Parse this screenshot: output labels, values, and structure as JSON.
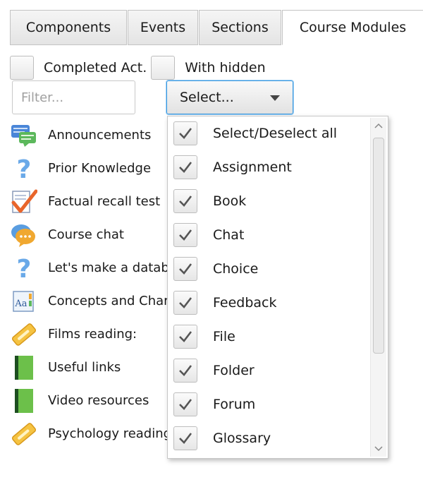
{
  "tabs": [
    {
      "label": "Components",
      "active": false
    },
    {
      "label": "Events",
      "active": false
    },
    {
      "label": "Sections",
      "active": false
    },
    {
      "label": "Course Modules",
      "active": true
    }
  ],
  "options": {
    "completed_label": "Completed Act.",
    "hidden_label": "With hidden"
  },
  "filter": {
    "placeholder": "Filter...",
    "value": ""
  },
  "select": {
    "label": "Select..."
  },
  "modules": [
    {
      "label": "Announcements",
      "icon": "forum-icon"
    },
    {
      "label": "Prior Knowledge",
      "icon": "question-icon"
    },
    {
      "label": "Factual recall test",
      "icon": "quiz-icon"
    },
    {
      "label": "Course chat",
      "icon": "chat-icon"
    },
    {
      "label": "Let's make a database",
      "icon": "question-icon"
    },
    {
      "label": "Concepts and Characters",
      "icon": "glossary-icon"
    },
    {
      "label": "Films reading:",
      "icon": "url-icon"
    },
    {
      "label": "Useful links",
      "icon": "book-icon"
    },
    {
      "label": "Video resources",
      "icon": "book-icon"
    },
    {
      "label": "Psychology reading:",
      "icon": "url-icon"
    }
  ],
  "dropdown": {
    "items": [
      {
        "label": "Select/Deselect all",
        "checked": true
      },
      {
        "label": "Assignment",
        "checked": true
      },
      {
        "label": "Book",
        "checked": true
      },
      {
        "label": "Chat",
        "checked": true
      },
      {
        "label": "Choice",
        "checked": true
      },
      {
        "label": "Feedback",
        "checked": true
      },
      {
        "label": "File",
        "checked": true
      },
      {
        "label": "Folder",
        "checked": true
      },
      {
        "label": "Forum",
        "checked": true
      },
      {
        "label": "Glossary",
        "checked": true
      }
    ]
  },
  "colors": {
    "select_focus": "#3c9ae0",
    "checkmark": "#555555"
  }
}
